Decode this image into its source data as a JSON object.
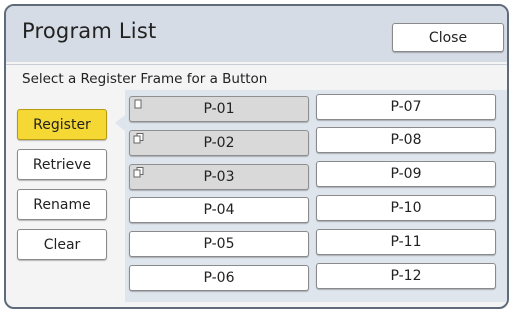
{
  "window": {
    "title": "Program List",
    "close_label": "Close"
  },
  "instruction": "Select a Register Frame for a Button",
  "side_buttons": [
    {
      "label": "Register",
      "active": true
    },
    {
      "label": "Retrieve",
      "active": false
    },
    {
      "label": "Rename",
      "active": false
    },
    {
      "label": "Clear",
      "active": false
    }
  ],
  "programs": [
    {
      "label": "P-01",
      "registered": true,
      "icon": "single-document-icon"
    },
    {
      "label": "P-02",
      "registered": true,
      "icon": "multi-document-icon"
    },
    {
      "label": "P-03",
      "registered": true,
      "icon": "multi-document-icon"
    },
    {
      "label": "P-04",
      "registered": false
    },
    {
      "label": "P-05",
      "registered": false
    },
    {
      "label": "P-06",
      "registered": false
    },
    {
      "label": "P-07",
      "registered": false
    },
    {
      "label": "P-08",
      "registered": false
    },
    {
      "label": "P-09",
      "registered": false
    },
    {
      "label": "P-10",
      "registered": false
    },
    {
      "label": "P-11",
      "registered": false
    },
    {
      "label": "P-12",
      "registered": false
    }
  ],
  "colors": {
    "accent": "#f5d834",
    "title_bar": "#d6dce6",
    "panel": "#dfe5ed"
  }
}
